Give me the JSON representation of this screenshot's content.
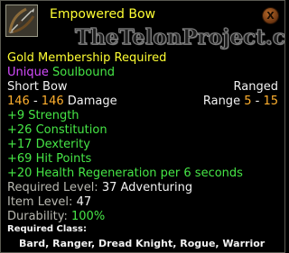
{
  "item": {
    "name": "Empowered Bow",
    "icon": "bow-icon",
    "watermark": "TheTelonProject.com",
    "requirement_banner": "Gold Membership Required",
    "rarity": "Unique",
    "binding": "Soulbound",
    "item_type": "Short Bow",
    "weapon_class": "Ranged",
    "damage": {
      "min": "146",
      "separator": " - ",
      "max": "146",
      "label": " Damage"
    },
    "range": {
      "label": "Range ",
      "min": "5",
      "separator": " - ",
      "max": "15"
    },
    "stats": [
      "+9 Strength",
      "+26 Constitution",
      "+17 Dexterity",
      "+69 Hit Points",
      "+20 Health Regeneration per 6 seconds"
    ],
    "required_level": {
      "label": "Required Level: ",
      "value": "37 Adventuring"
    },
    "item_level": {
      "label": "Item Level: ",
      "value": "47"
    },
    "durability": {
      "label": "Durability: ",
      "value": "100%"
    },
    "required_class_label": "Required Class:",
    "required_classes": "Bard, Ranger, Dread Knight, Rogue, Warrior"
  },
  "close_label": "X",
  "colors": {
    "name": "#ffff33",
    "rarity_unique": "#d54cff",
    "soulbound": "#46e646",
    "stat_bonus": "#46e646",
    "damage_value": "#ffb02e",
    "durability_value": "#46e646"
  }
}
